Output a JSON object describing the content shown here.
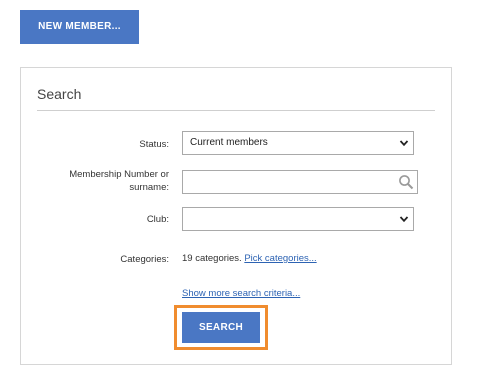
{
  "toolbar": {
    "new_member_label": "NEW MEMBER..."
  },
  "search_panel": {
    "title": "Search",
    "status": {
      "label": "Status:",
      "selected": "Current members"
    },
    "membership": {
      "label_line1": "Membership Number or",
      "label_line2": "surname:",
      "value": "",
      "placeholder": ""
    },
    "club": {
      "label": "Club:",
      "selected": ""
    },
    "categories": {
      "label": "Categories:",
      "summary": "19 categories.",
      "link_label": "Pick categories..."
    },
    "show_more_label": "Show more search criteria...",
    "search_button_label": "SEARCH"
  },
  "icons": {
    "chevron": "chevron-down-icon",
    "search": "search-icon"
  },
  "colors": {
    "button_bg": "#4a77c4",
    "link": "#2d63b3",
    "highlight": "#f08c2e",
    "border": "#d6d6d6"
  }
}
